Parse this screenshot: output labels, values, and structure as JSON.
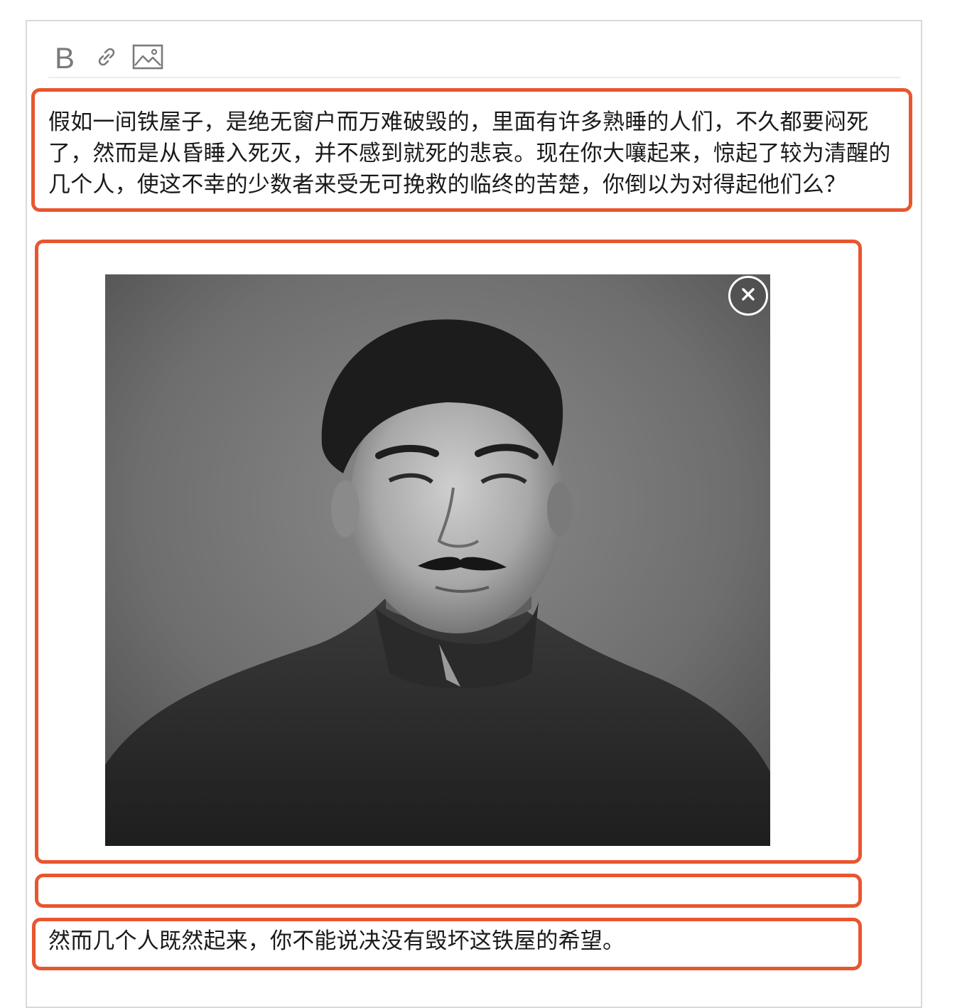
{
  "toolbar": {
    "bold_label": "B",
    "link_icon": "link-icon",
    "image_icon": "image-icon"
  },
  "content": {
    "paragraph_1": "假如一间铁屋子，是绝无窗户而万难破毁的，里面有许多熟睡的人们，不久都要闷死了，然而是从昏睡入死灭，并不感到就死的悲哀。现在你大嚷起来，惊起了较为清醒的几个人，使这不幸的少数者来受无可挽救的临终的苦楚，你倒以为对得起他们么？",
    "image": {
      "alt": "portrait photo",
      "remove_icon": "close-circle-icon"
    },
    "empty_block": "",
    "paragraph_2": "然而几个人既然起来，你不能说决没有毁坏这铁屋的希望。"
  },
  "colors": {
    "highlight_border": "#e8562f",
    "toolbar_icon": "#7a7a7a",
    "editor_border": "#d9d9d9",
    "text": "#1a1a1a"
  }
}
